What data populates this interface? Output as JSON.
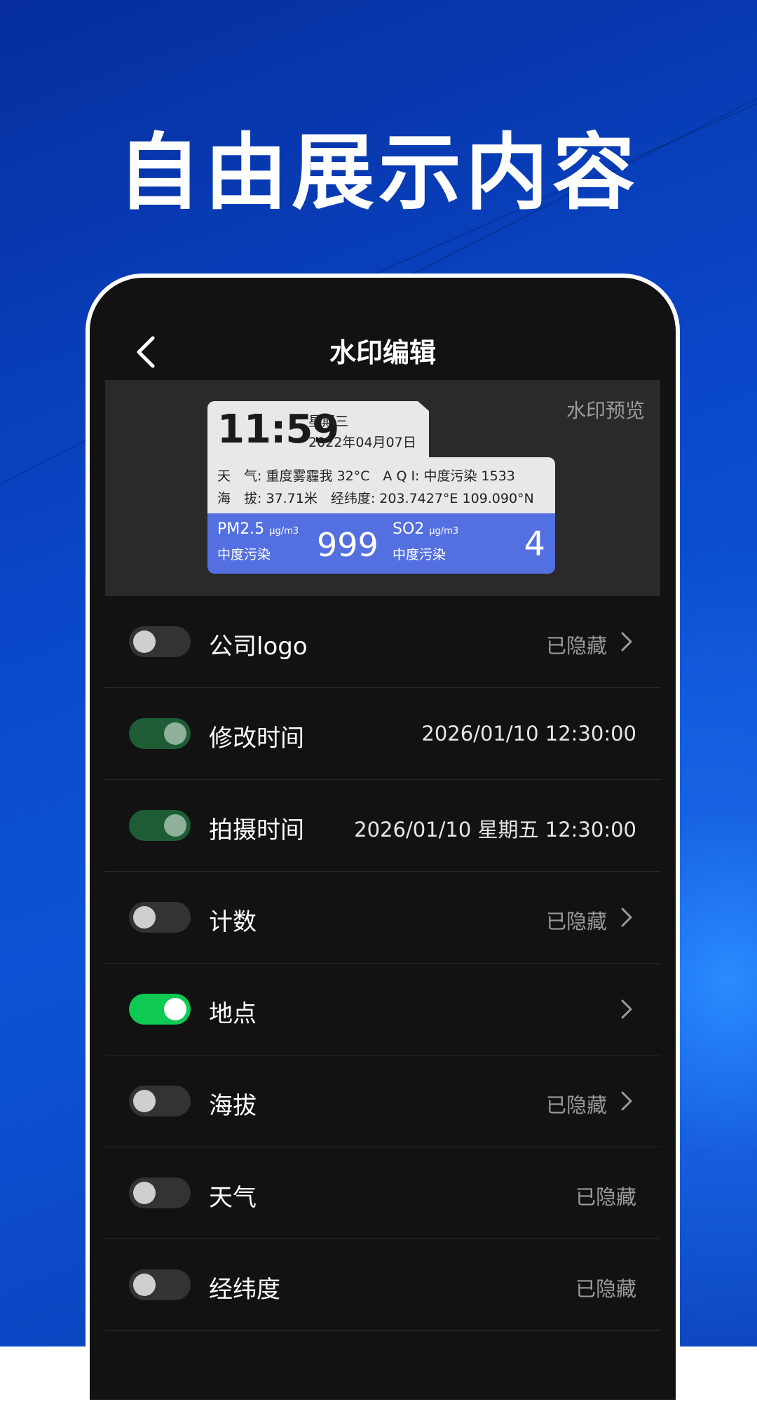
{
  "headline": "自由展示内容",
  "nav": {
    "title": "水印编辑",
    "back_icon": "chevron-left-icon"
  },
  "preview": {
    "label": "水印预览",
    "watermark": {
      "time": "11:59",
      "weekday": "星期三",
      "date": "2022年04月07日",
      "line1": "天　气: 重度雾霾我 32°C　A Q I: 中度污染 1533",
      "line2": "海　拔: 37.71米　经纬度: 203.7427°E 109.090°N",
      "pm_label": "PM2.5",
      "pm_unit": "μg/m3",
      "pm_level": "中度污染",
      "pm_value": "999",
      "so2_label": "SO2",
      "so2_unit": "μg/m3",
      "so2_level": "中度污染",
      "so2_value": "4",
      "accent_color": "#5470e0"
    }
  },
  "rows": [
    {
      "label": "公司logo",
      "value": "已隐藏",
      "toggle": "off",
      "chevron": true
    },
    {
      "label": "修改时间",
      "value": "2026/01/10 12:30:00",
      "toggle": "on-dim",
      "chevron": false
    },
    {
      "label": "拍摄时间",
      "value": "2026/01/10 星期五 12:30:00",
      "toggle": "on-dim",
      "chevron": false
    },
    {
      "label": "计数",
      "value": "已隐藏",
      "toggle": "off",
      "chevron": true
    },
    {
      "label": "地点",
      "value": "",
      "toggle": "on",
      "chevron": true
    },
    {
      "label": "海拔",
      "value": "已隐藏",
      "toggle": "off",
      "chevron": true
    },
    {
      "label": "天气",
      "value": "已隐藏",
      "toggle": "off",
      "chevron": false
    },
    {
      "label": "经纬度",
      "value": "已隐藏",
      "toggle": "off",
      "chevron": false
    }
  ],
  "colors": {
    "toggle_on": "#0fca52",
    "toggle_on_dim": "#1d5c34",
    "panel_bg": "#121212"
  }
}
